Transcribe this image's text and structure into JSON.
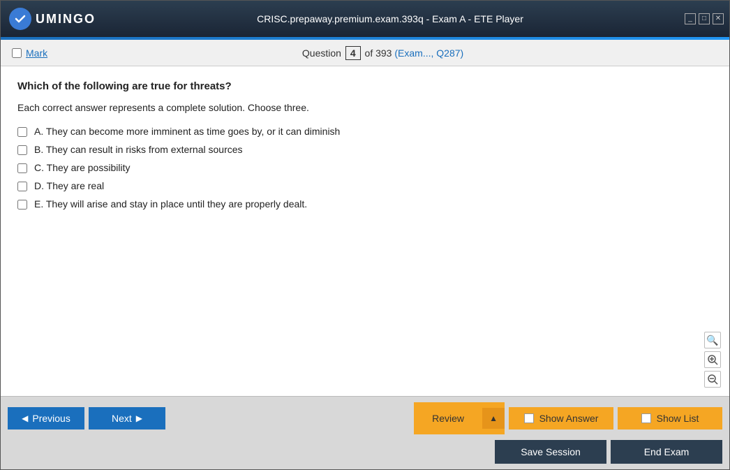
{
  "titlebar": {
    "title": "CRISC.prepaway.premium.exam.393q - Exam A - ETE Player",
    "logo_text": "UMINGO",
    "minimize": "_",
    "maximize": "□",
    "close": "✕"
  },
  "toolbar": {
    "mark_label": "Mark",
    "question_label": "Question",
    "question_number": "4",
    "question_total": "of 393",
    "question_ref": "(Exam..., Q287)"
  },
  "question": {
    "title": "Which of the following are true for threats?",
    "instruction": "Each correct answer represents a complete solution. Choose three.",
    "options": [
      {
        "id": "A",
        "text": "A. They can become more imminent as time goes by, or it can diminish"
      },
      {
        "id": "B",
        "text": "B. They can result in risks from external sources"
      },
      {
        "id": "C",
        "text": "C. They are possibility"
      },
      {
        "id": "D",
        "text": "D. They are real"
      },
      {
        "id": "E",
        "text": "E. They will arise and stay in place until they are properly dealt."
      }
    ]
  },
  "zoom": {
    "search_icon": "🔍",
    "zoom_in_icon": "+",
    "zoom_out_icon": "−"
  },
  "buttons": {
    "previous": "Previous",
    "next": "Next",
    "review": "Review",
    "show_answer": "Show Answer",
    "show_list": "Show List",
    "save_session": "Save Session",
    "end_exam": "End Exam"
  }
}
